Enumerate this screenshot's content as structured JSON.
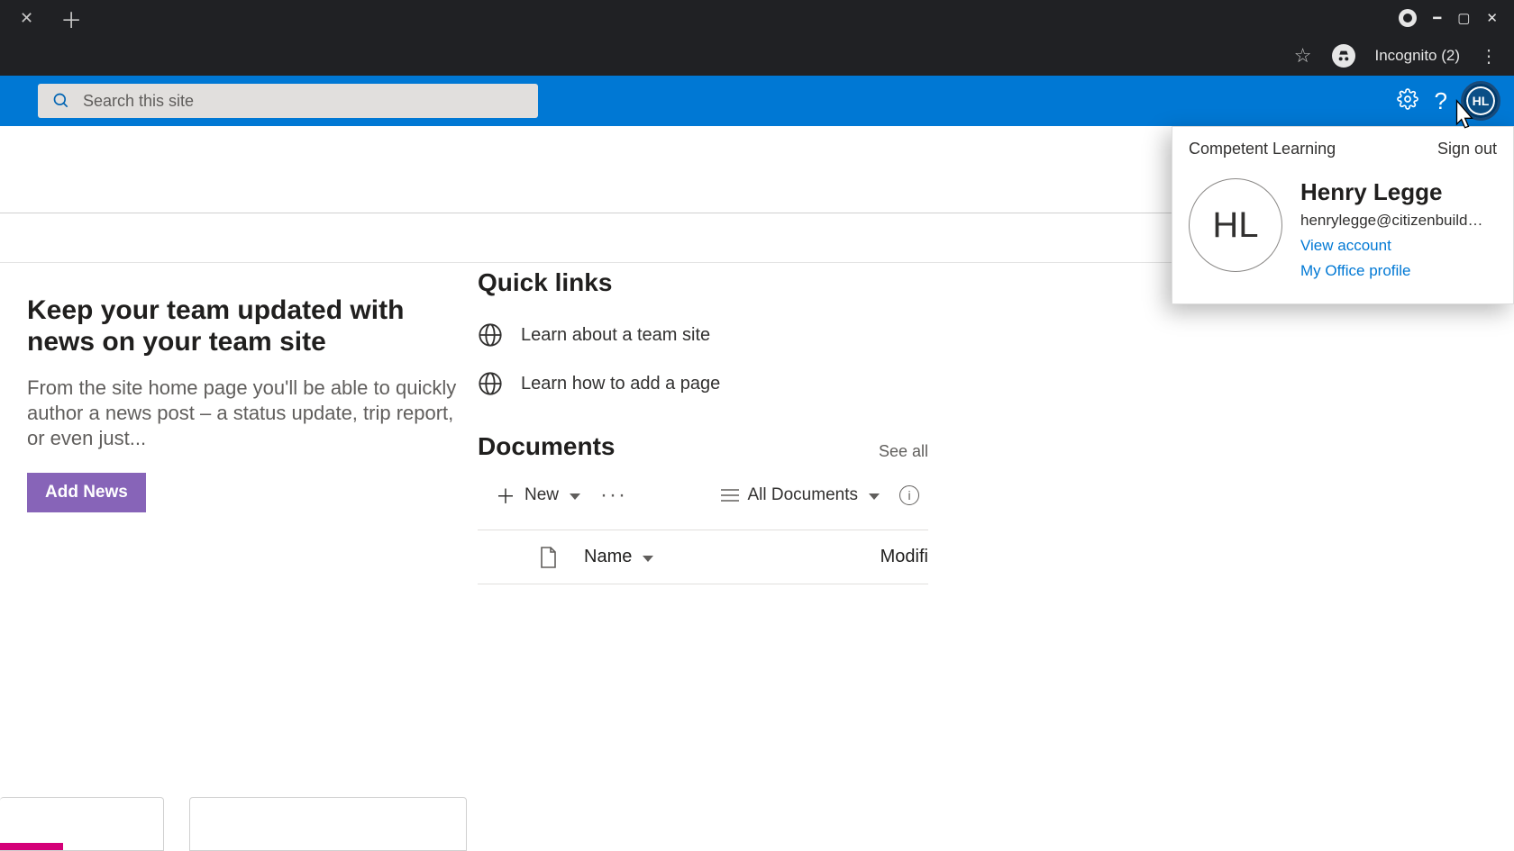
{
  "browser": {
    "incognito_label": "Incognito (2)"
  },
  "search": {
    "placeholder": "Search this site"
  },
  "user": {
    "initials": "HL",
    "org": "Competent Learning",
    "sign_out": "Sign out",
    "name": "Henry Legge",
    "email": "henrylegge@citizenbuilders.o...",
    "view_account": "View account",
    "office_profile": "My Office profile"
  },
  "news": {
    "title": "Keep your team updated with news on your team site",
    "body": "From the site home page you'll be able to quickly author a news post – a status update, trip report, or even just...",
    "add_label": "Add News"
  },
  "quick_links": {
    "title": "Quick links",
    "items": [
      {
        "label": "Learn about a team site"
      },
      {
        "label": "Learn how to add a page"
      }
    ]
  },
  "documents": {
    "title": "Documents",
    "see_all": "See all",
    "new_label": "New",
    "view_label": "All Documents",
    "col_name": "Name",
    "col_modified": "Modifi"
  }
}
